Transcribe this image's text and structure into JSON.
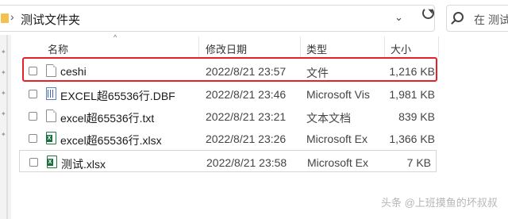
{
  "address_bar": {
    "path": "测试文件夹"
  },
  "search": {
    "placeholder": "在 测试"
  },
  "columns": {
    "name": "名称",
    "modified": "修改日期",
    "type": "类型",
    "size": "大小"
  },
  "files": [
    {
      "name": "ceshi",
      "modified": "2022/8/21 23:57",
      "type": "文件",
      "size": "1,216 KB",
      "icon": "generic-file-icon"
    },
    {
      "name": "EXCEL超65536行.DBF",
      "modified": "2022/8/21 23:46",
      "type": "Microsoft Vis",
      "size": "1,981 KB",
      "icon": "dbf-file-icon"
    },
    {
      "name": "excel超65536行.txt",
      "modified": "2022/8/21 23:21",
      "type": "文本文档",
      "size": "839 KB",
      "icon": "text-file-icon"
    },
    {
      "name": "excel超65536行.xlsx",
      "modified": "2022/8/21 23:26",
      "type": "Microsoft Ex",
      "size": "1,366 KB",
      "icon": "excel-file-icon"
    },
    {
      "name": "测试.xlsx",
      "modified": "2022/8/21 23:58",
      "type": "Microsoft Ex",
      "size": "7 KB",
      "icon": "excel-file-icon"
    }
  ],
  "watermark": "头条 @上班摸鱼的坏叔叔",
  "colors": {
    "highlight": "#e8202a",
    "excel_green": "#1d6f42"
  }
}
